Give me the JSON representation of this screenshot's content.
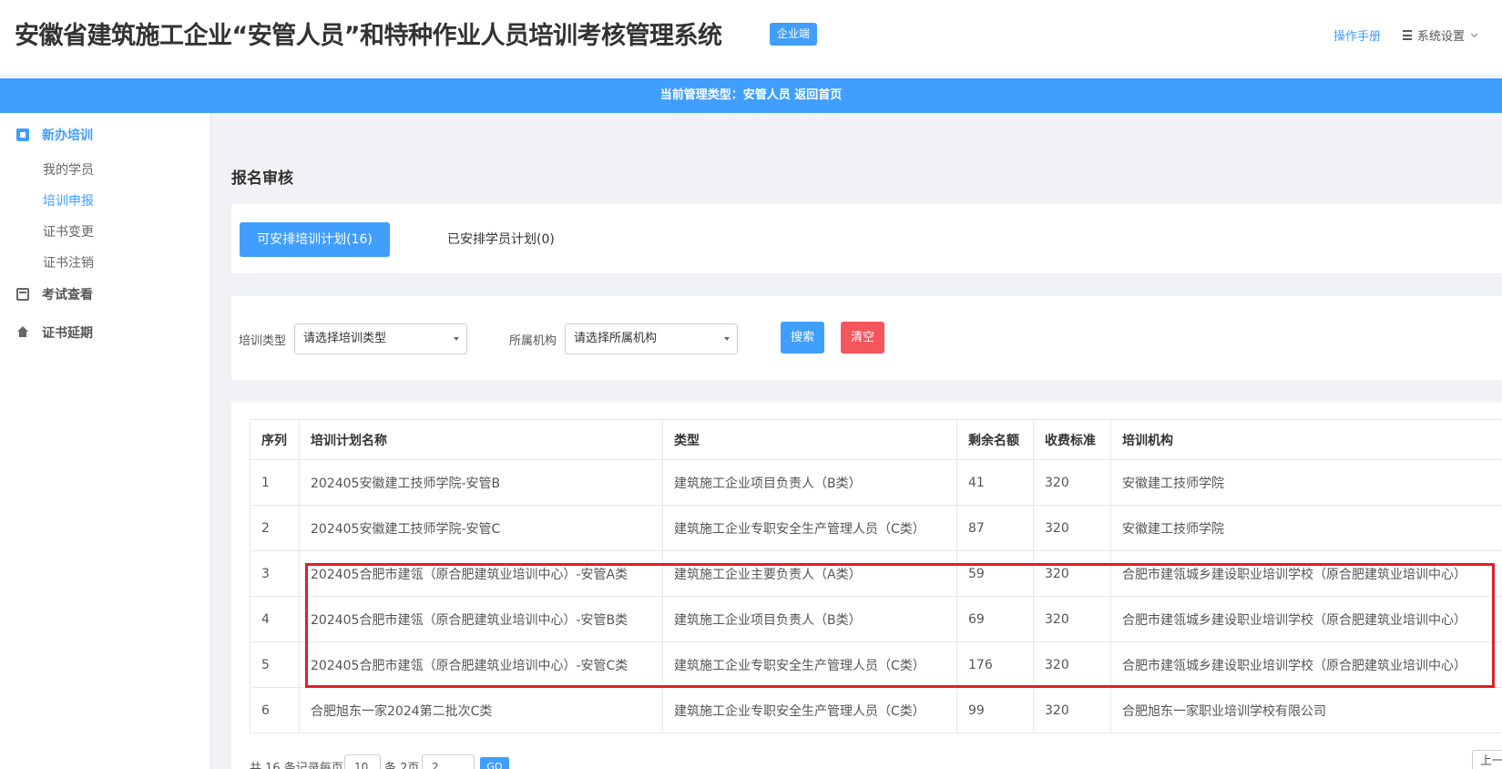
{
  "header": {
    "title": "安徽省建筑施工企业“安管人员”和特种作业人员培训考核管理系统",
    "edition_badge": "企业端",
    "manual_link": "操作手册",
    "settings_label": "系统设置"
  },
  "type_bar": {
    "text": "当前管理类型：安管人员",
    "back_link": "返回首页"
  },
  "sidebar": {
    "groups": [
      {
        "label": "新办培训",
        "icon": "clipboard-icon",
        "items": [
          "我的学员",
          "培训申报",
          "证书变更",
          "证书注销"
        ]
      },
      {
        "label": "考试查看",
        "icon": "calendar-icon"
      },
      {
        "label": "证书延期",
        "icon": "home-icon"
      }
    ],
    "active_item": "培训申报"
  },
  "page": {
    "title": "报名审核"
  },
  "tabs": [
    {
      "label": "可安排培训计划(16)",
      "active": true
    },
    {
      "label": "已安排学员计划(0)",
      "active": false
    }
  ],
  "filters": {
    "type_label": "培训类型",
    "type_placeholder": "请选择培训类型",
    "org_label": "所属机构",
    "org_placeholder": "请选择所属机构",
    "search_button": "搜索",
    "clear_button": "清空"
  },
  "table": {
    "columns": [
      "序列",
      "培训计划名称",
      "类型",
      "剩余名额",
      "收费标准",
      "培训机构"
    ],
    "rows": [
      [
        "1",
        "202405安徽建工技师学院-安管B",
        "建筑施工企业项目负责人（B类）",
        "41",
        "320",
        "安徽建工技师学院"
      ],
      [
        "2",
        "202405安徽建工技师学院-安管C",
        "建筑施工企业专职安全生产管理人员（C类）",
        "87",
        "320",
        "安徽建工技师学院"
      ],
      [
        "3",
        "202405合肥市建瓴（原合肥建筑业培训中心）-安管A类",
        "建筑施工企业主要负责人（A类）",
        "59",
        "320",
        "合肥市建瓴城乡建设职业培训学校（原合肥建筑业培训中心）"
      ],
      [
        "4",
        "202405合肥市建瓴（原合肥建筑业培训中心）-安管B类",
        "建筑施工企业项目负责人（B类）",
        "69",
        "320",
        "合肥市建瓴城乡建设职业培训学校（原合肥建筑业培训中心）"
      ],
      [
        "5",
        "202405合肥市建瓴（原合肥建筑业培训中心）-安管C类",
        "建筑施工企业专职安全生产管理人员（C类）",
        "176",
        "320",
        "合肥市建瓴城乡建设职业培训学校（原合肥建筑业培训中心）"
      ],
      [
        "6",
        "合肥旭东一家2024第二批次C类",
        "建筑施工企业专职安全生产管理人员（C类）",
        "99",
        "320",
        "合肥旭东一家职业培训学校有限公司"
      ]
    ]
  },
  "pagination": {
    "total_text": "共 16 条记录每页",
    "page_size": "10",
    "pages_text": "条 2页",
    "page_input": "2",
    "go_label": "GO",
    "prev_label": "上一页"
  }
}
